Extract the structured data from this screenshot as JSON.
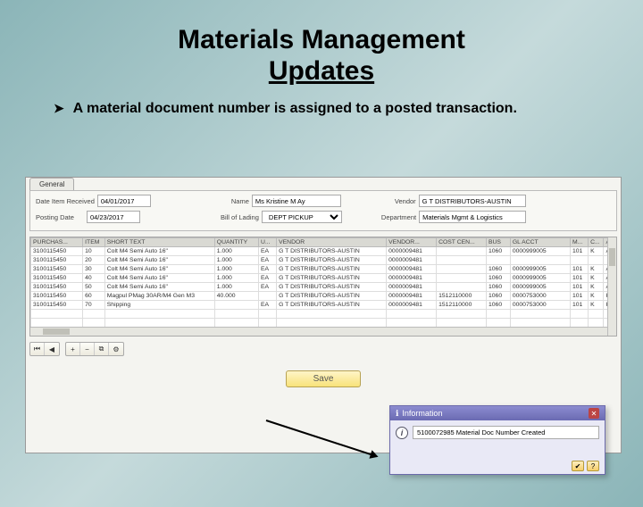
{
  "title_line1": "Materials Management",
  "title_line2": "Updates",
  "bullet_text": "A material document number is assigned to a posted transaction.",
  "tab_label": "General",
  "fields": {
    "date_received_label": "Date Item Received",
    "date_received_value": "04/01/2017",
    "posting_date_label": "Posting Date",
    "posting_date_value": "04/23/2017",
    "name_label": "Name",
    "name_value": "Ms Kristine M Ay",
    "bill_lading_label": "Bill of Lading",
    "bill_lading_value": "DEPT PICKUP",
    "vendor_label": "Vendor",
    "vendor_value": "G T DISTRIBUTORS-AUSTIN",
    "department_label": "Department",
    "department_value": "Materials Mgmt & Logistics"
  },
  "columns": [
    "PURCHAS...",
    "ITEM",
    "SHORT TEXT",
    "QUANTITY",
    "U...",
    "VENDOR",
    "VENDOR...",
    "COST CEN...",
    "BUS",
    "GL ACCT",
    "M...",
    "C...",
    "A"
  ],
  "rows": [
    {
      "po": "3100115450",
      "item": "10",
      "text": "Colt M4 Semi Auto 16\"",
      "qty": "1.000",
      "unit": "EA",
      "vendor": "G T DISTRIBUTORS-AUSTIN",
      "vno": "0000009481",
      "cc": "",
      "bus": "1060",
      "gl": "0000999005",
      "m": "101",
      "c": "K",
      "a": "A"
    },
    {
      "po": "3100115450",
      "item": "20",
      "text": "Colt M4 Semi Auto 16\"",
      "qty": "1.000",
      "unit": "EA",
      "vendor": "G T DISTRIBUTORS-AUSTIN",
      "vno": "0000009481",
      "cc": "",
      "bus": "",
      "gl": "",
      "m": "",
      "c": "",
      "a": ""
    },
    {
      "po": "3100115450",
      "item": "30",
      "text": "Colt M4 Semi Auto 16\"",
      "qty": "1.000",
      "unit": "EA",
      "vendor": "G T DISTRIBUTORS-AUSTIN",
      "vno": "0000009481",
      "cc": "",
      "bus": "1060",
      "gl": "0000999005",
      "m": "101",
      "c": "K",
      "a": "A"
    },
    {
      "po": "3100115450",
      "item": "40",
      "text": "Colt M4 Semi Auto 16\"",
      "qty": "1.000",
      "unit": "EA",
      "vendor": "G T DISTRIBUTORS-AUSTIN",
      "vno": "0000009481",
      "cc": "",
      "bus": "1060",
      "gl": "0000999005",
      "m": "101",
      "c": "K",
      "a": "A"
    },
    {
      "po": "3100115450",
      "item": "50",
      "text": "Colt M4 Semi Auto 16\"",
      "qty": "1.000",
      "unit": "EA",
      "vendor": "G T DISTRIBUTORS-AUSTIN",
      "vno": "0000009481",
      "cc": "",
      "bus": "1060",
      "gl": "0000999005",
      "m": "101",
      "c": "K",
      "a": "A"
    },
    {
      "po": "3100115450",
      "item": "60",
      "text": "Magpul PMag 30AR/M4 Gen M3",
      "qty": "40.000",
      "unit": "",
      "vendor": "G T DISTRIBUTORS-AUSTIN",
      "vno": "0000009481",
      "cc": "1512110000",
      "bus": "1060",
      "gl": "0000753000",
      "m": "101",
      "c": "K",
      "a": "K"
    },
    {
      "po": "3100115450",
      "item": "70",
      "text": "Shipping",
      "qty": "",
      "unit": "EA",
      "vendor": "G T DISTRIBUTORS-AUSTIN",
      "vno": "0000009481",
      "cc": "1512110000",
      "bus": "1060",
      "gl": "0000753000",
      "m": "101",
      "c": "K",
      "a": "K"
    }
  ],
  "save_label": "Save",
  "popup": {
    "title": "Information",
    "message": "5100072985 Material Doc Number Created"
  }
}
